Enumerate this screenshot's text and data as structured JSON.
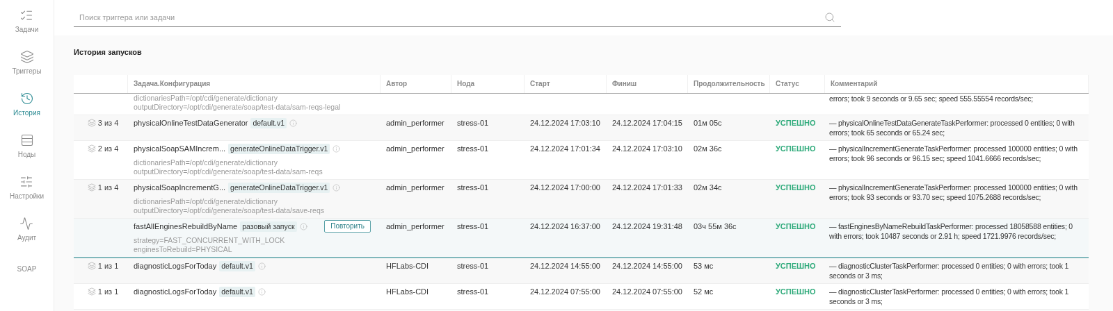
{
  "sidebar": {
    "items": [
      {
        "kind": "tasks",
        "label": "Задачи",
        "selected": false
      },
      {
        "kind": "triggers",
        "label": "Триггеры",
        "selected": false
      },
      {
        "kind": "history",
        "label": "История",
        "selected": true
      },
      {
        "kind": "nodes",
        "label": "Ноды",
        "selected": false
      },
      {
        "kind": "settings",
        "label": "Настройки",
        "selected": false
      },
      {
        "kind": "audit",
        "label": "Аудит",
        "selected": false
      },
      {
        "kind": "text",
        "label": "SOAP",
        "selected": false
      }
    ]
  },
  "search": {
    "placeholder": "Поиск триггера или задачи"
  },
  "section_title": "История запусков",
  "table": {
    "columns": [
      "Задача.Конфигурация",
      "Автор",
      "Нода",
      "Старт",
      "Финиш",
      "Продолжительность",
      "Статус",
      "Комментарий"
    ],
    "rows": [
      {
        "partial": true,
        "params": [
          "dictionariesPath=/opt/cdi/generate/dictionary",
          "outputDirectory=/opt/cdi/generate/soap/test-data/sam-reqs-legal"
        ],
        "comment": "errors; took 9 seconds or 9.65 sec; speed 555.55554 records/sec;",
        "selected": false
      },
      {
        "group": "3 из 4",
        "name": "physicalOnlineTestDataGenerator",
        "tag": "default.v1",
        "params": [],
        "author": "admin_performer",
        "node": "stress-01",
        "start": "24.12.2024 17:03:10",
        "finish": "24.12.2024 17:04:15",
        "duration": "01м 05с",
        "status": {
          "kind": "success",
          "label": "УСПЕШНО"
        },
        "comment": "— physicalOnlineTestDataGenerateTaskPerformer: processed 0 entities; 0 with errors; took 65 seconds or 65.24 sec;",
        "selected": false
      },
      {
        "group": "2 из 4",
        "name": "physicalSoapSAMIncrem...",
        "tag": "generateOnlineDataTrigger.v1",
        "params": [
          "dictionariesPath=/opt/cdi/generate/dictionary",
          "outputDirectory=/opt/cdi/generate/soap/test-data/sam-reqs"
        ],
        "author": "admin_performer",
        "node": "stress-01",
        "start": "24.12.2024 17:01:34",
        "finish": "24.12.2024 17:03:10",
        "duration": "02м 36с",
        "status": {
          "kind": "success",
          "label": "УСПЕШНО"
        },
        "comment": "— physicalIncrementGenerateTaskPerformer: processed 100000 entities; 0 with errors; took 96 seconds or 96.15 sec; speed 1041.6666 records/sec;",
        "selected": false
      },
      {
        "group": "1 из 4",
        "name": "physicalSoapIncrementG...",
        "tag": "generateOnlineDataTrigger.v1",
        "params": [
          "dictionariesPath=/opt/cdi/generate/dictionary",
          "outputDirectory=/opt/cdi/generate/soap/test-data/save-reqs"
        ],
        "author": "admin_performer",
        "node": "stress-01",
        "start": "24.12.2024 17:00:00",
        "finish": "24.12.2024 17:01:33",
        "duration": "02м 34с",
        "status": {
          "kind": "success",
          "label": "УСПЕШНО"
        },
        "comment": "— physicalIncrementGenerateTaskPerformer: processed 100000 entities; 0 with errors; took 93 seconds or 93.70 sec; speed 1075.2688 records/sec;",
        "selected": false
      },
      {
        "name": "fastAllEnginesRebuildByName",
        "tag": "разовый запуск",
        "retry": "Повторить",
        "params": [
          "strategy=FAST_CONCURRENT_WITH_LOCK",
          "enginesToRebuild=PHYSICAL"
        ],
        "author": "admin_performer",
        "node": "stress-01",
        "start": "24.12.2024 16:37:00",
        "finish": "24.12.2024 19:31:48",
        "duration": "03ч 55м 36с",
        "status": {
          "kind": "success",
          "label": "УСПЕШНО"
        },
        "comment": "— fastEnginesByNameRebuildTaskPerformer: processed 18058588 entities; 0 with errors; took 10487 seconds or 2.91 h; speed 1721.9976 records/sec;",
        "selected": true
      },
      {
        "group": "1 из 1",
        "name": "diagnosticLogsForToday",
        "tag": "default.v1",
        "params": [],
        "author": "HFLabs-CDI",
        "node": "stress-01",
        "start": "24.12.2024 14:55:00",
        "finish": "24.12.2024 14:55:00",
        "duration": "53 мс",
        "status": {
          "kind": "success",
          "label": "УСПЕШНО"
        },
        "comment": "— diagnosticClusterTaskPerformer: processed 0 entities; 0 with errors; took 1 seconds or 3 ms;",
        "selected": false
      },
      {
        "group": "1 из 1",
        "name": "diagnosticLogsForToday",
        "tag": "default.v1",
        "params": [],
        "author": "HFLabs-CDI",
        "node": "stress-01",
        "start": "24.12.2024 07:55:00",
        "finish": "24.12.2024 07:55:00",
        "duration": "52 мс",
        "status": {
          "kind": "success",
          "label": "УСПЕШНО"
        },
        "comment": "— diagnosticClusterTaskPerformer: processed 0 entities; 0 with errors; took 1 seconds or 3 ms;",
        "selected": false
      }
    ]
  }
}
